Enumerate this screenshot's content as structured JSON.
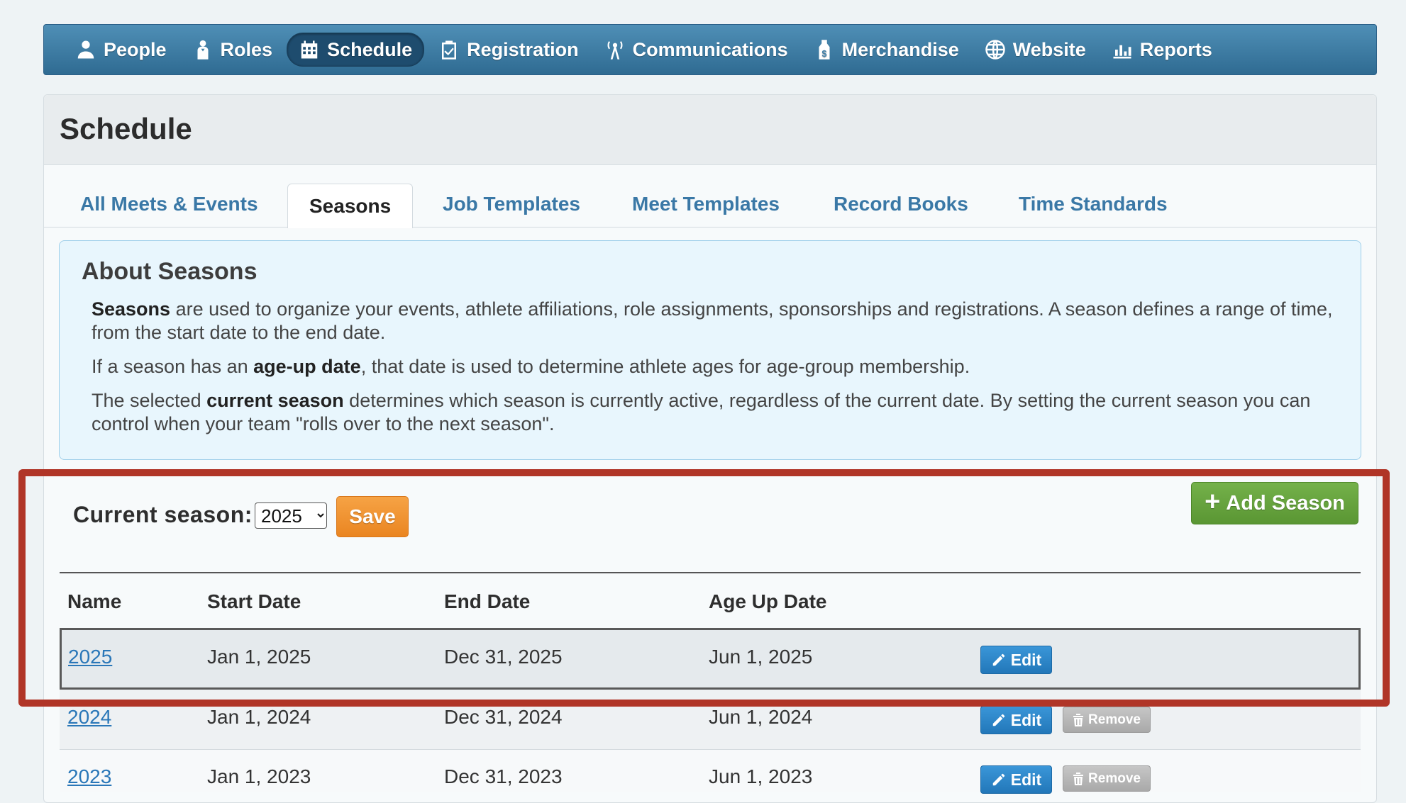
{
  "nav": {
    "items": [
      {
        "label": "People",
        "icon": "person-icon"
      },
      {
        "label": "Roles",
        "icon": "role-icon"
      },
      {
        "label": "Schedule",
        "icon": "calendar-icon",
        "active": true
      },
      {
        "label": "Registration",
        "icon": "clipboard-check-icon"
      },
      {
        "label": "Communications",
        "icon": "broadcast-icon"
      },
      {
        "label": "Merchandise",
        "icon": "price-tag-icon"
      },
      {
        "label": "Website",
        "icon": "globe-icon"
      },
      {
        "label": "Reports",
        "icon": "bar-chart-icon"
      }
    ]
  },
  "page": {
    "title": "Schedule"
  },
  "tabs": [
    {
      "label": "All Meets & Events"
    },
    {
      "label": "Seasons",
      "active": true
    },
    {
      "label": "Job Templates"
    },
    {
      "label": "Meet Templates"
    },
    {
      "label": "Record Books"
    },
    {
      "label": "Time Standards"
    }
  ],
  "about": {
    "title": "About Seasons",
    "p1_bold": "Seasons",
    "p1_rest": " are used to organize your events, athlete affiliations, role assignments, sponsorships and registrations. A season defines a range of time, from the start date to the end date.",
    "p2_pre": "If a season has an ",
    "p2_bold": "age-up date",
    "p2_rest": ", that date is used to determine athlete ages for age-group membership.",
    "p3_pre": "The selected ",
    "p3_bold": "current season",
    "p3_rest": " determines which season is currently active, regardless of the current date. By setting the current season you can control when your team \"rolls over to the next season\"."
  },
  "current_season": {
    "label": "Current season:",
    "selected": "2025",
    "save_label": "Save"
  },
  "add_season_label": "Add Season",
  "table": {
    "headers": {
      "name": "Name",
      "start": "Start Date",
      "end": "End Date",
      "ageup": "Age Up Date"
    },
    "rows": [
      {
        "name": "2025",
        "start": "Jan 1, 2025",
        "end": "Dec 31, 2025",
        "ageup": "Jun 1, 2025",
        "edit": "Edit"
      },
      {
        "name": "2024",
        "start": "Jan 1, 2024",
        "end": "Dec 31, 2024",
        "ageup": "Jun 1, 2024",
        "edit": "Edit",
        "remove": "Remove"
      },
      {
        "name": "2023",
        "start": "Jan 1, 2023",
        "end": "Dec 31, 2023",
        "ageup": "Jun 1, 2023",
        "edit": "Edit",
        "remove": "Remove"
      }
    ]
  },
  "colors": {
    "nav": "#3f7fa8",
    "save": "#ee8c27",
    "add": "#66a33e",
    "edit": "#2a84c8",
    "highlight": "#b03527"
  }
}
